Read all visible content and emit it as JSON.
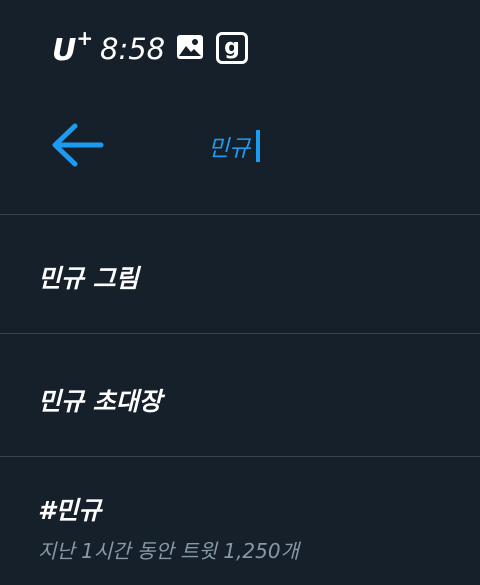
{
  "status_bar": {
    "carrier": "U",
    "carrier_plus": "+",
    "time": "8:58",
    "icons": [
      "image-icon",
      "g-app-icon"
    ],
    "g_label": "g"
  },
  "search": {
    "query": "민규",
    "back_icon": "back-arrow-icon",
    "accent_color": "#1d9bf0"
  },
  "suggestions": [
    {
      "label": "민규 그림"
    },
    {
      "label": "민규 초대장"
    },
    {
      "label": "#민규",
      "meta": "지난 1시간 동안 트윗 1,250개"
    }
  ],
  "colors": {
    "background": "#15202b",
    "divider": "#38444d",
    "secondary_text": "#8899a6"
  }
}
